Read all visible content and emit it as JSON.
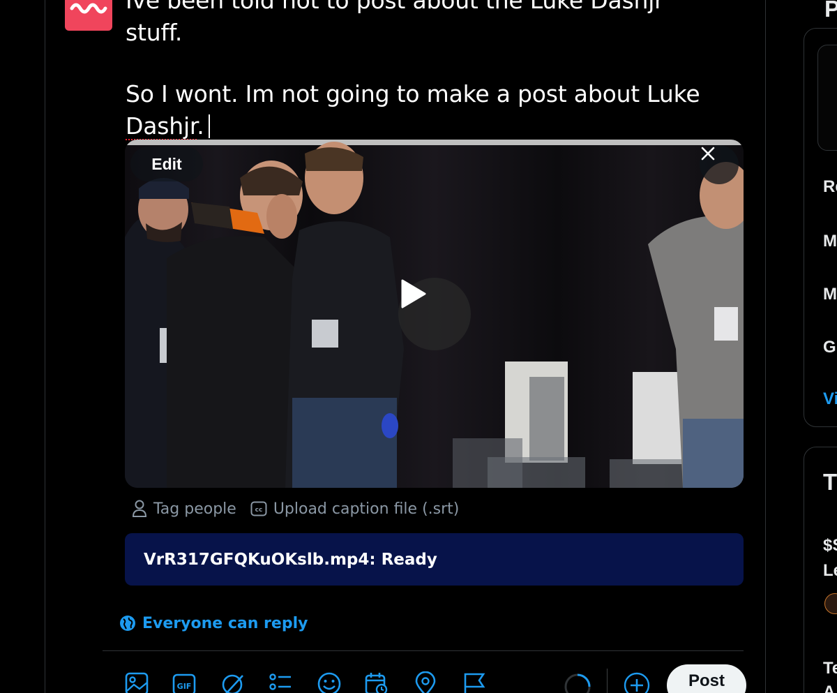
{
  "compose": {
    "line1": "Ive been told not to post about the Luke Dashjr stuff.",
    "line2_prefix": "So I wont. Im not going to make a post about Luke ",
    "line2_misspelled": "Dashjr",
    "line2_suffix": "."
  },
  "media": {
    "edit_label": "Edit",
    "close_icon": "close-icon",
    "play_icon": "play-icon",
    "tag_people_label": "Tag people",
    "caption_label": "Upload caption file (.srt)",
    "upload_status": "VrR317GFQKuOKslb.mp4: Ready"
  },
  "reply_setting": {
    "label": "Everyone can reply",
    "icon": "globe-icon"
  },
  "toolbar": {
    "icons": [
      "image-icon",
      "gif-icon",
      "grok-icon",
      "poll-icon",
      "emoji-icon",
      "schedule-icon",
      "location-icon",
      "flag-icon"
    ],
    "gif_text": "GIF",
    "post_label": "Post",
    "add_icon": "add-post-icon"
  },
  "right_sidebar": {
    "title": "P",
    "items": [
      "Re",
      "M",
      "M",
      "G"
    ],
    "link": "Vi",
    "section2_title": "T",
    "trend_line1": "$S",
    "trend_line2": "Le",
    "trend3": "Te",
    "trend3b": "A"
  },
  "colors": {
    "accent": "#1d9bf0",
    "upload_bg": "#07134a",
    "avatar": "#f0455c",
    "post_button": "#eff3f4"
  }
}
